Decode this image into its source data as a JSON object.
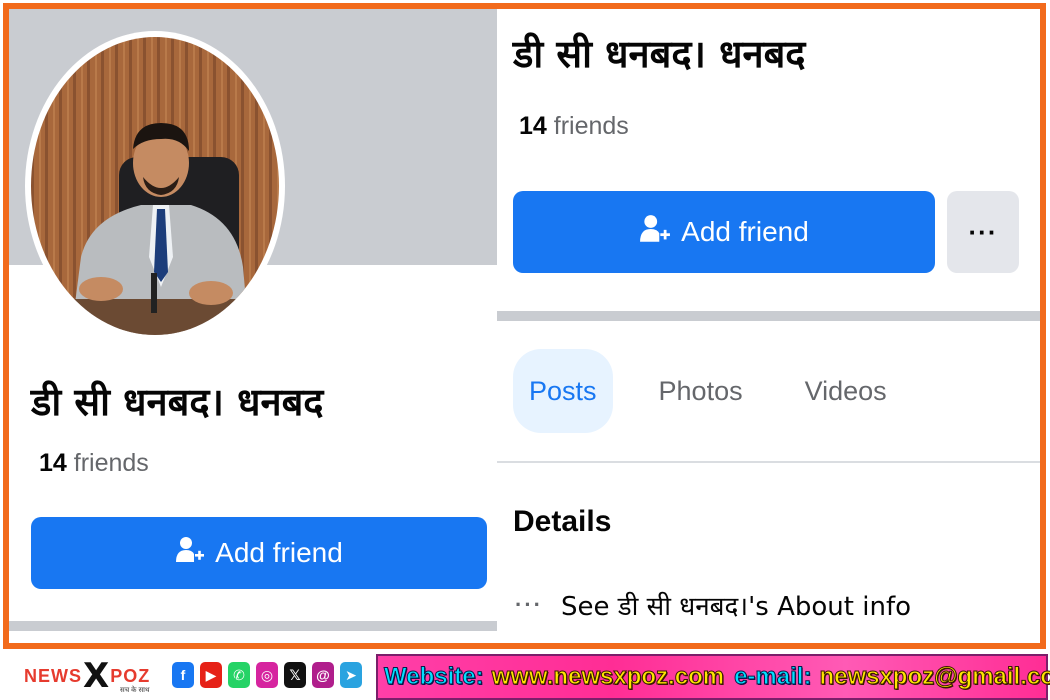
{
  "profile": {
    "name": "डी सी धनबद। धनबद",
    "friends_count": "14",
    "friends_label": "friends"
  },
  "actions": {
    "add_friend_label": "Add friend",
    "more_label": "···"
  },
  "tabs": [
    {
      "label": "Posts",
      "active": true
    },
    {
      "label": "Photos",
      "active": false
    },
    {
      "label": "Videos",
      "active": false
    }
  ],
  "details": {
    "heading": "Details",
    "about_label": "See डी सी धनबद।'s About info",
    "about_icon_label": "···"
  },
  "brand": {
    "logo_news": "NEWS",
    "logo_x": "X",
    "logo_poz": "POZ",
    "logo_tagline": "सच के साथ",
    "website_label": "Website:",
    "website_url": "www.newsxpoz.com",
    "email_label": "e-mail:",
    "email": "newsxpoz@gmail.com"
  },
  "colors": {
    "frame": "#f26a1b",
    "accent": "#1877f2",
    "cover": "#c9ccd1"
  },
  "icons": {
    "add_friend": "person-add-icon",
    "more": "more-dots-icon",
    "socials": [
      "facebook-icon",
      "youtube-icon",
      "whatsapp-icon",
      "instagram-icon",
      "x-icon",
      "threads-icon",
      "telegram-icon"
    ]
  }
}
